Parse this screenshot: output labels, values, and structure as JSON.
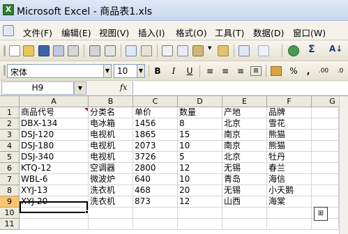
{
  "window": {
    "title": "Microsoft Excel - 商品表1.xls"
  },
  "menu": [
    "文件(F)",
    "编辑(E)",
    "视图(V)",
    "插入(I)",
    "格式(O)",
    "工具(T)",
    "数据(D)",
    "窗口(W)"
  ],
  "toolbar": {
    "sigma": "Σ",
    "sort": "A↓"
  },
  "format": {
    "font_name": "宋体",
    "font_size": "10",
    "bold": "B",
    "italic": "I",
    "underline": "U",
    "percent": "%",
    "comma": ",",
    "inc_decimal": ".00",
    "dec_decimal": ".0"
  },
  "formula_bar": {
    "name_box": "H9",
    "fx": "fx",
    "content": ""
  },
  "columns": [
    "A",
    "B",
    "C",
    "D",
    "E",
    "F",
    "G"
  ],
  "rows": [
    "1",
    "2",
    "3",
    "4",
    "5",
    "6",
    "7",
    "8",
    "9",
    "10",
    "11"
  ],
  "data": [
    [
      "商品代号",
      "分类名",
      "单价",
      "数量",
      "产地",
      "品牌"
    ],
    [
      "DBX-134",
      "电冰箱",
      "1456",
      "8",
      "北京",
      "雪花"
    ],
    [
      "DSJ-120",
      "电视机",
      "1865",
      "15",
      "南京",
      "熊猫"
    ],
    [
      "DSJ-180",
      "电视机",
      "2073",
      "10",
      "南京",
      "熊猫"
    ],
    [
      "DSJ-340",
      "电视机",
      "3726",
      "5",
      "北京",
      "牡丹"
    ],
    [
      "KTQ-12",
      "空调器",
      "2800",
      "12",
      "无锡",
      "春兰"
    ],
    [
      "WBL-6",
      "微波炉",
      "640",
      "10",
      "青岛",
      "海信"
    ],
    [
      "XYJ-13",
      "洗衣机",
      "468",
      "20",
      "无锡",
      "小天鹅"
    ],
    [
      "XYJ-20",
      "洗衣机",
      "873",
      "12",
      "山西",
      "海棠"
    ]
  ]
}
